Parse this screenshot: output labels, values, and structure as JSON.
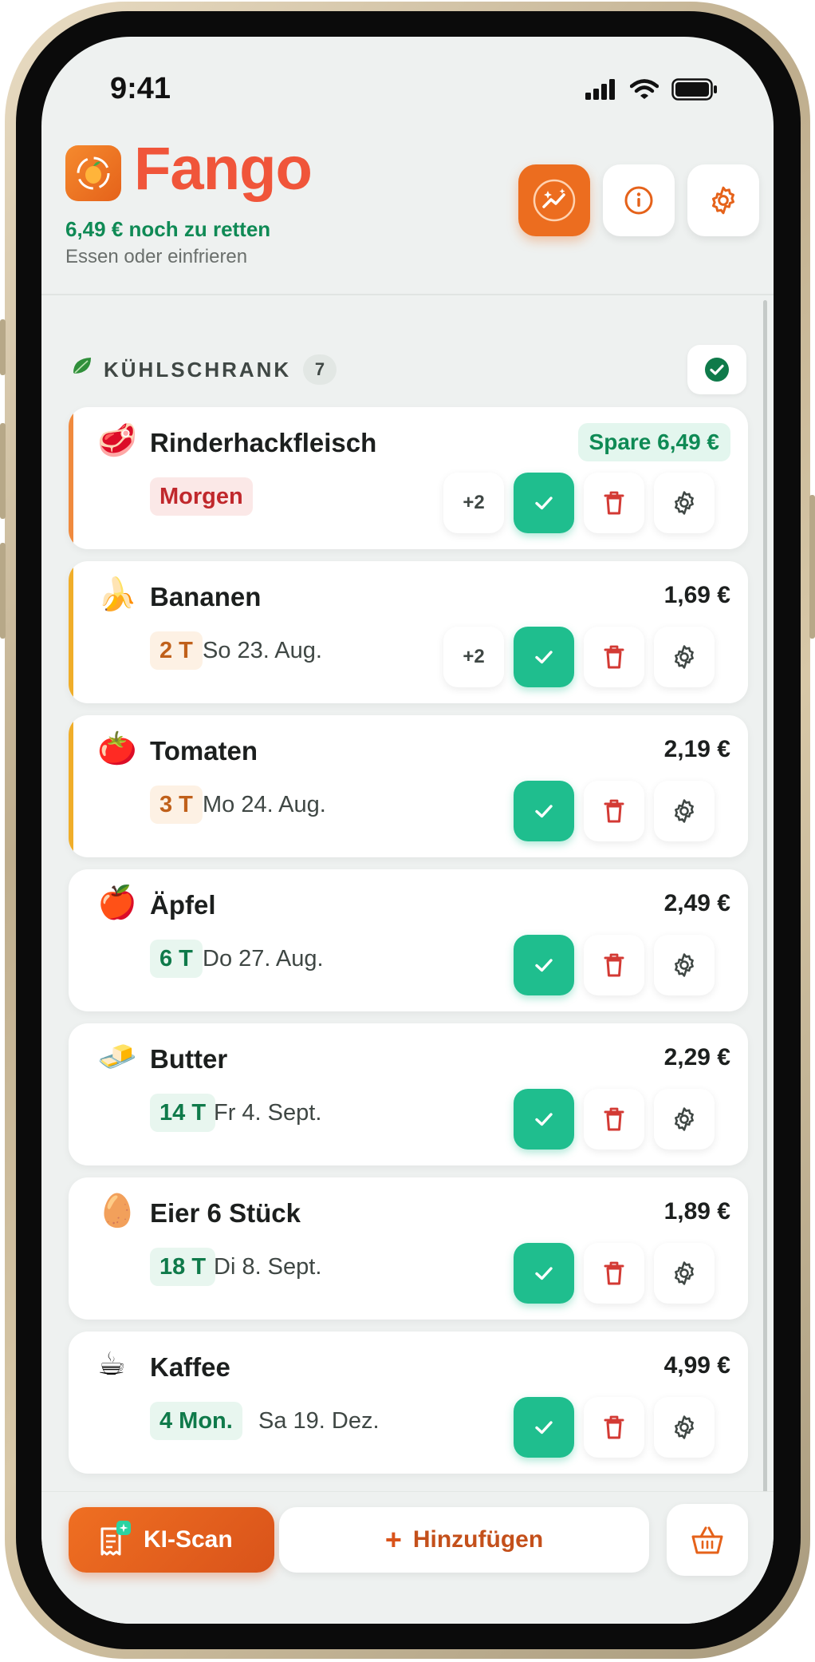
{
  "status": {
    "time": "9:41"
  },
  "header": {
    "title": "Fango",
    "remaining": "6,49 € noch zu retten",
    "subtitle": "Essen oder einfrieren"
  },
  "section": {
    "title": "KÜHLSCHRANK",
    "count": "7"
  },
  "items": [
    {
      "name": "Rinderhackfleisch",
      "emoji": "🥩",
      "price": "Spare 6,49 €",
      "badge": "Morgen",
      "date": "",
      "more": "+2"
    },
    {
      "name": "Bananen",
      "emoji": "🍌",
      "price": "1,69 €",
      "badge": "2 T",
      "date": "So 23. Aug.",
      "more": "+2"
    },
    {
      "name": "Tomaten",
      "emoji": "🍅",
      "price": "2,19 €",
      "badge": "3 T",
      "date": "Mo 24. Aug.",
      "more": ""
    },
    {
      "name": "Äpfel",
      "emoji": "🍎",
      "price": "2,49 €",
      "badge": "6 T",
      "date": "Do 27. Aug.",
      "more": ""
    },
    {
      "name": "Butter",
      "emoji": "🧈",
      "price": "2,29 €",
      "badge": "14 T",
      "date": "Fr 4. Sept.",
      "more": ""
    },
    {
      "name": "Eier 6 Stück",
      "emoji": "🥚",
      "price": "1,89 €",
      "badge": "18 T",
      "date": "Di 8. Sept.",
      "more": ""
    },
    {
      "name": "Kaffee",
      "emoji": "☕",
      "price": "4,99 €",
      "badge": "4 Mon.",
      "date": "Sa 19. Dez.",
      "more": ""
    }
  ],
  "bottom": {
    "scan_label": "KI-Scan",
    "add_plus": "+",
    "add_label": "Hinzufügen"
  },
  "colors": {
    "brand": "#f0553a",
    "orange": "#ec6d1f",
    "green": "#1fbe8e",
    "urgent_red": "#c0282c",
    "soon_orange": "#c8601a",
    "ok_green": "#0f8a55"
  }
}
